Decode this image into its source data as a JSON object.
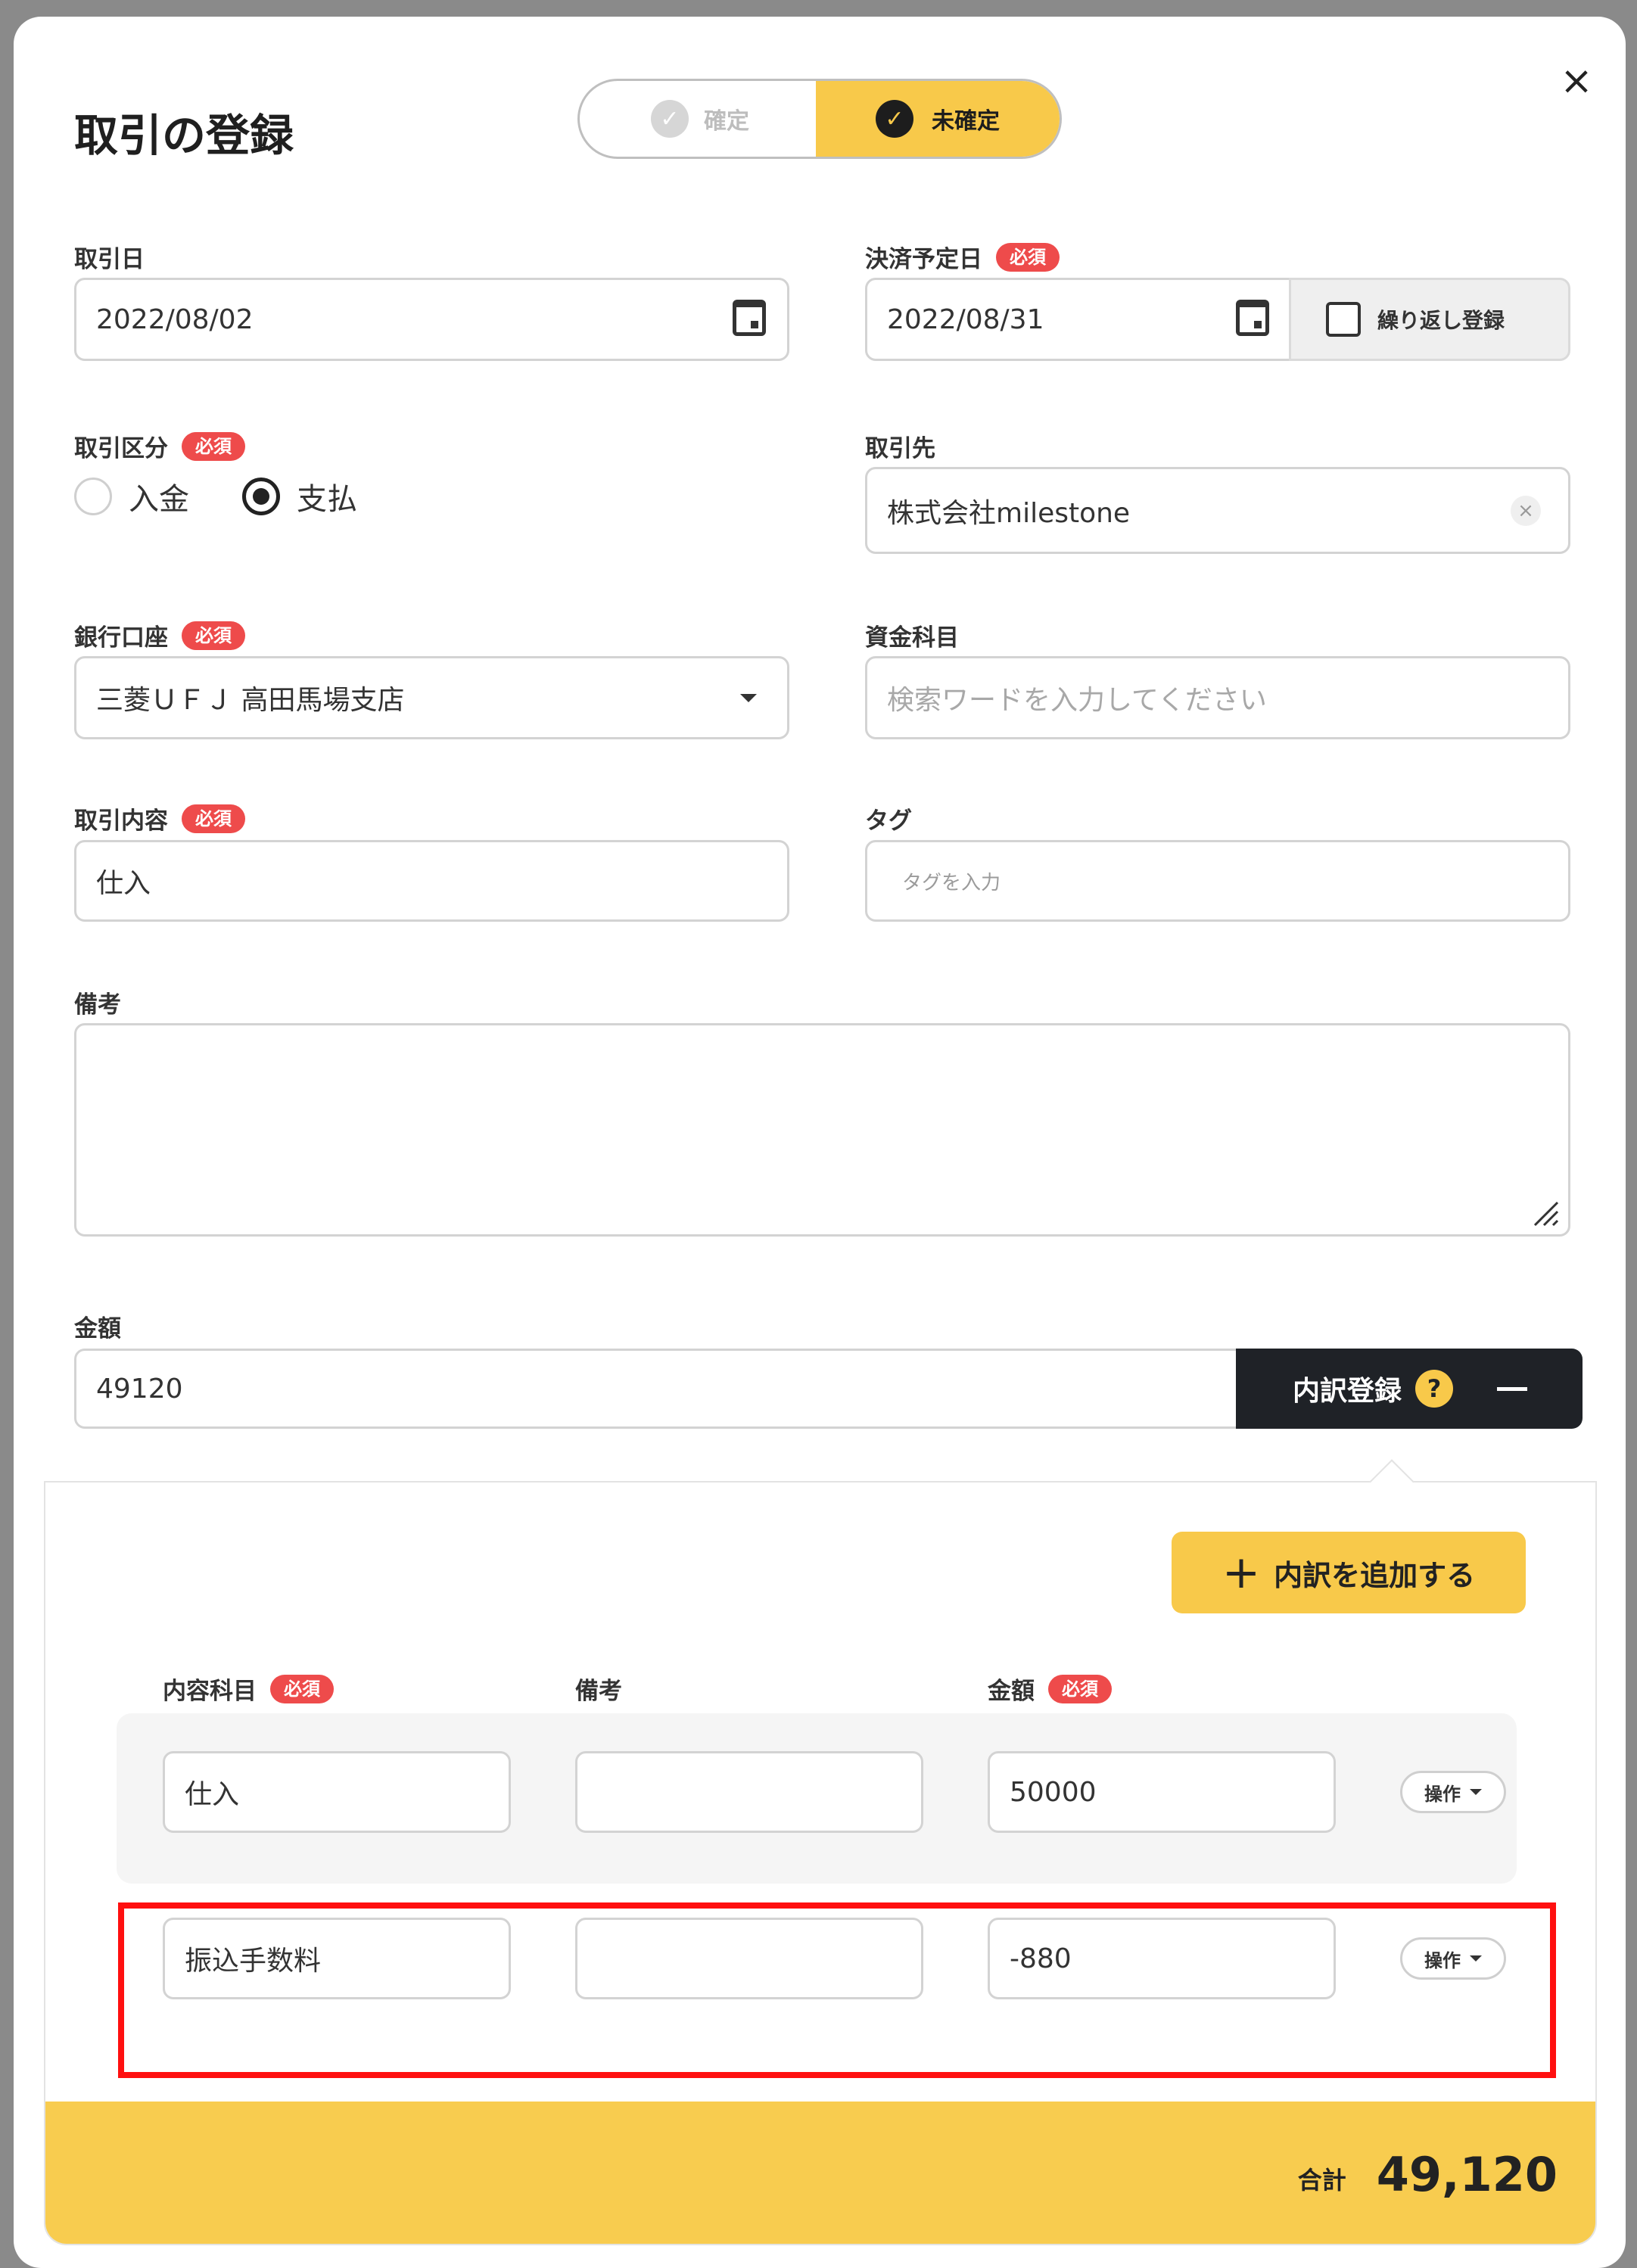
{
  "dialog": {
    "title": "取引の登録",
    "close_icon": "×"
  },
  "status_toggle": {
    "confirmed_label": "確定",
    "unconfirmed_label": "未確定",
    "selected": "未確定"
  },
  "required_badge": "必須",
  "fields": {
    "transaction_date": {
      "label": "取引日",
      "value": "2022/08/02"
    },
    "due_date": {
      "label": "決済予定日",
      "value": "2022/08/31"
    },
    "repeat": {
      "label": "繰り返し登録",
      "checked": false
    },
    "transaction_type": {
      "label": "取引区分",
      "options": [
        "入金",
        "支払"
      ],
      "selected": "支払"
    },
    "partner": {
      "label": "取引先",
      "value": "株式会社milestone"
    },
    "bank_account": {
      "label": "銀行口座",
      "value": "三菱ＵＦＪ 高田馬場支店"
    },
    "fund_item": {
      "label": "資金科目",
      "placeholder": "検索ワードを入力してください"
    },
    "content": {
      "label": "取引内容",
      "value": "仕入"
    },
    "tag": {
      "label": "タグ",
      "placeholder": "タグを入力"
    },
    "memo": {
      "label": "備考",
      "value": ""
    },
    "amount": {
      "label": "金額",
      "value": "49120"
    }
  },
  "breakdown": {
    "toggle_label": "内訳登録",
    "help_icon": "?",
    "add_label": "内訳を追加する",
    "headers": {
      "item": "内容科目",
      "memo": "備考",
      "amount": "金額"
    },
    "operation_label": "操作",
    "rows": [
      {
        "item": "仕入",
        "memo": "",
        "amount": "50000"
      },
      {
        "item": "振込手数料",
        "memo": "",
        "amount": "-880"
      }
    ],
    "total_label": "合計",
    "total_value": "49,120"
  },
  "colors": {
    "accent": "#f8c94a",
    "required": "#ee4b4b",
    "dark_button": "#1f2227",
    "highlight": "#ff1010"
  }
}
